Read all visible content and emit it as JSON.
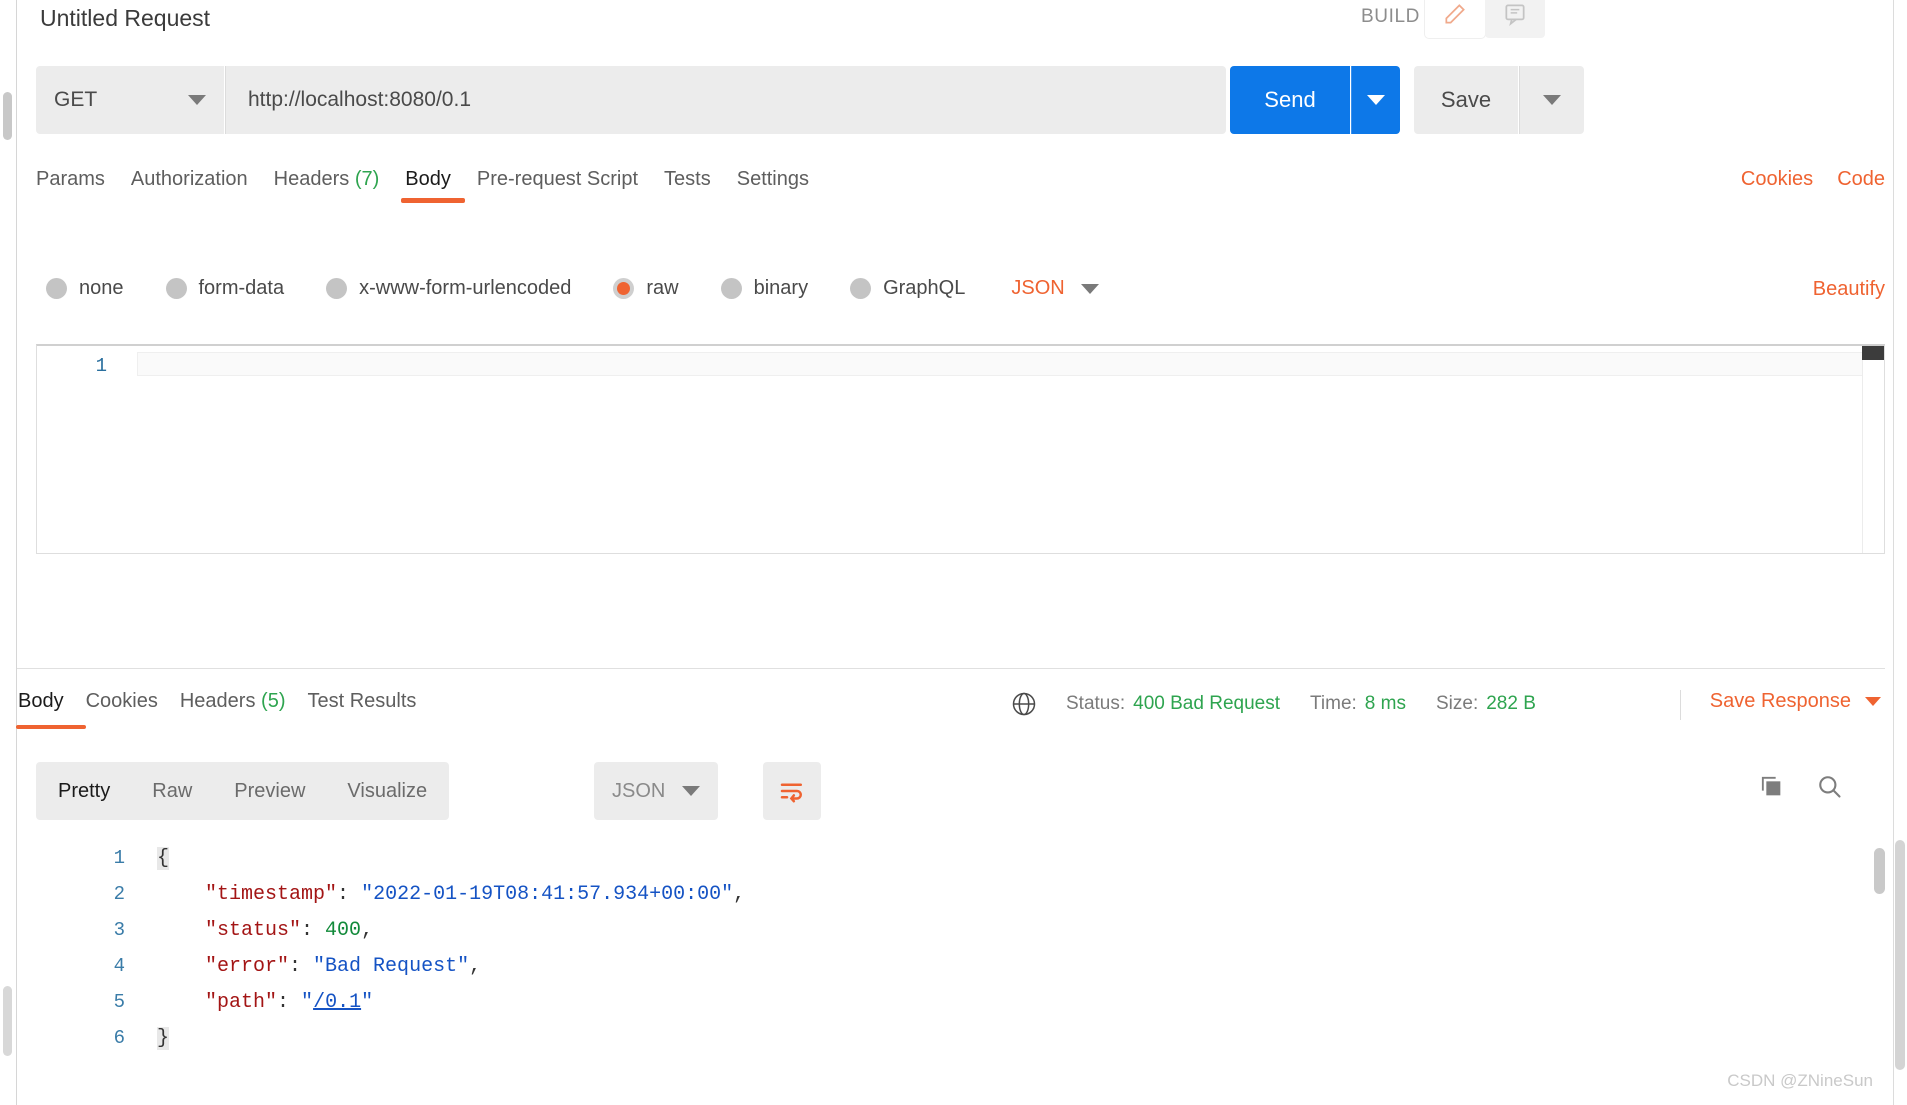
{
  "header": {
    "request_title": "Untitled Request",
    "build_label": "BUILD",
    "pencil_icon": "pencil-icon",
    "comment_icon": "comment-icon"
  },
  "url_bar": {
    "method": "GET",
    "url": "http://localhost:8080/0.1",
    "send_label": "Send",
    "save_label": "Save"
  },
  "request_tabs": [
    {
      "label": "Params",
      "active": false
    },
    {
      "label": "Authorization",
      "active": false
    },
    {
      "label": "Headers",
      "count": "(7)",
      "active": false
    },
    {
      "label": "Body",
      "active": true
    },
    {
      "label": "Pre-request Script",
      "active": false
    },
    {
      "label": "Tests",
      "active": false
    },
    {
      "label": "Settings",
      "active": false
    }
  ],
  "request_links": [
    {
      "label": "Cookies"
    },
    {
      "label": "Code"
    }
  ],
  "body_types": [
    {
      "label": "none",
      "selected": false
    },
    {
      "label": "form-data",
      "selected": false
    },
    {
      "label": "x-www-form-urlencoded",
      "selected": false
    },
    {
      "label": "raw",
      "selected": true
    },
    {
      "label": "binary",
      "selected": false
    },
    {
      "label": "GraphQL",
      "selected": false
    }
  ],
  "body_format": "JSON",
  "beautify_label": "Beautify",
  "request_editor": {
    "line_number": "1",
    "content": ""
  },
  "response_tabs": [
    {
      "label": "Body",
      "active": true
    },
    {
      "label": "Cookies",
      "active": false
    },
    {
      "label": "Headers",
      "count": "(5)",
      "active": false
    },
    {
      "label": "Test Results",
      "active": false
    }
  ],
  "response_status": {
    "globe_icon": "globe-icon",
    "status_label": "Status:",
    "status_value": "400 Bad Request",
    "time_label": "Time:",
    "time_value": "8 ms",
    "size_label": "Size:",
    "size_value": "282 B",
    "save_response_label": "Save Response"
  },
  "response_toolbar": {
    "formats": [
      {
        "label": "Pretty",
        "active": true
      },
      {
        "label": "Raw",
        "active": false
      },
      {
        "label": "Preview",
        "active": false
      },
      {
        "label": "Visualize",
        "active": false
      }
    ],
    "content_type": "JSON",
    "wrap_icon": "word-wrap-icon",
    "copy_icon": "copy-icon",
    "search_icon": "search-icon"
  },
  "response_body": {
    "lines": [
      {
        "no": "1",
        "segments": [
          {
            "t": "{",
            "c": "br"
          }
        ]
      },
      {
        "no": "2",
        "segments": [
          {
            "t": "    ",
            "c": "p"
          },
          {
            "t": "\"timestamp\"",
            "c": "k"
          },
          {
            "t": ": ",
            "c": "p"
          },
          {
            "t": "\"2022-01-19T08:41:57.934+00:00\"",
            "c": "s"
          },
          {
            "t": ",",
            "c": "p"
          }
        ]
      },
      {
        "no": "3",
        "segments": [
          {
            "t": "    ",
            "c": "p"
          },
          {
            "t": "\"status\"",
            "c": "k"
          },
          {
            "t": ": ",
            "c": "p"
          },
          {
            "t": "400",
            "c": "n"
          },
          {
            "t": ",",
            "c": "p"
          }
        ]
      },
      {
        "no": "4",
        "segments": [
          {
            "t": "    ",
            "c": "p"
          },
          {
            "t": "\"error\"",
            "c": "k"
          },
          {
            "t": ": ",
            "c": "p"
          },
          {
            "t": "\"Bad Request\"",
            "c": "s"
          },
          {
            "t": ",",
            "c": "p"
          }
        ]
      },
      {
        "no": "5",
        "segments": [
          {
            "t": "    ",
            "c": "p"
          },
          {
            "t": "\"path\"",
            "c": "k"
          },
          {
            "t": ": ",
            "c": "p"
          },
          {
            "t": "\"",
            "c": "s"
          },
          {
            "t": "/0.1",
            "c": "s-underline"
          },
          {
            "t": "\"",
            "c": "s"
          }
        ]
      },
      {
        "no": "6",
        "segments": [
          {
            "t": "}",
            "c": "br"
          }
        ]
      }
    ]
  },
  "watermark": "CSDN @ZNineSun",
  "colors": {
    "accent_orange": "#ef6331",
    "send_blue": "#0d78e8",
    "status_green": "#2ea44f",
    "json_key": "#a31515",
    "json_string": "#1553c4",
    "json_number": "#128a3a"
  }
}
